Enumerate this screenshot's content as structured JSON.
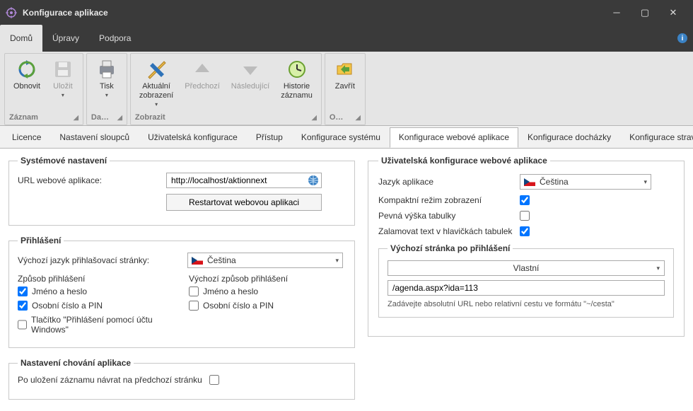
{
  "window": {
    "title": "Konfigurace aplikace"
  },
  "menus": {
    "home": "Domů",
    "edit": "Úpravy",
    "support": "Podpora"
  },
  "ribbon": {
    "refresh": "Obnovit",
    "save": "Uložit",
    "print": "Tisk",
    "current_view": "Aktuální\nzobrazení",
    "prev": "Předchozí",
    "next": "Následující",
    "history": "Historie\nzáznamu",
    "close": "Zavřít",
    "grp_record": "Záznam",
    "grp_da": "Da…",
    "grp_show": "Zobrazit",
    "grp_o": "O…"
  },
  "tabs": {
    "license": "Licence",
    "cols": "Nastavení sloupců",
    "userconf": "Uživatelská konfigurace",
    "access": "Přístup",
    "sysconf": "Konfigurace systému",
    "webconf": "Konfigurace webové aplikace",
    "attendance": "Konfigurace docházky",
    "catering": "Konfigurace stravován"
  },
  "sys": {
    "legend": "Systémové nastavení",
    "url_label": "URL webové aplikace:",
    "url_value": "http://localhost/aktionnext",
    "restart_btn": "Restartovat webovou aplikaci"
  },
  "login": {
    "legend": "Přihlášení",
    "default_lang_label": "Výchozí jazyk přihlašovací stránky:",
    "lang_value": "Čeština",
    "method_title": "Způsob přihlášení",
    "default_method_title": "Výchozí způsob přihlášení",
    "m_userpass": "Jméno a heslo",
    "m_pin": "Osobní číslo a PIN",
    "m_win": "Tlačítko \"Přihlášení pomocí účtu Windows\""
  },
  "behavior": {
    "legend": "Nastavení chování aplikace",
    "return_label": "Po uložení záznamu návrat na předchozí stránku"
  },
  "userweb": {
    "legend": "Uživatelská konfigurace webové aplikace",
    "app_lang_label": "Jazyk aplikace",
    "app_lang_value": "Čeština",
    "compact_label": "Kompaktní režim zobrazení",
    "fixed_h_label": "Pevná výška tabulky",
    "wrap_label": "Zalamovat text v hlavičkách tabulek",
    "start_legend": "Výchozí stránka po přihlášení",
    "start_select": "Vlastní",
    "start_url": "/agenda.aspx?ida=113",
    "start_hint": "Zadávejte absolutní URL nebo relativní cestu ve formátu \"~/cesta\""
  }
}
